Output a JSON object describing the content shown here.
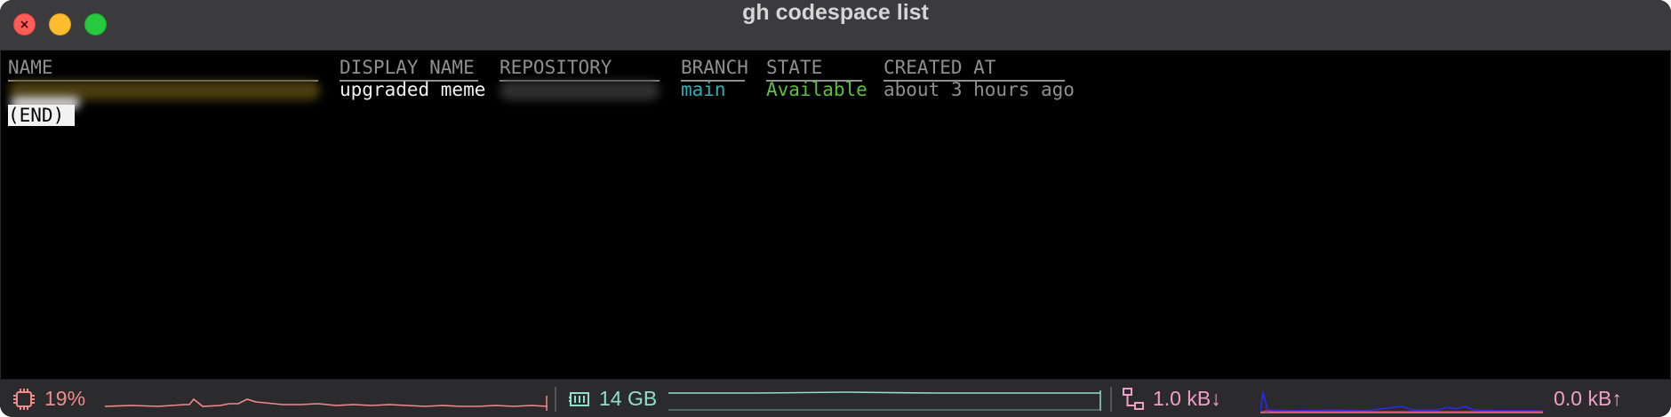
{
  "window": {
    "title": "gh codespace list"
  },
  "table": {
    "headers": {
      "name": "NAME",
      "display_name": "DISPLAY NAME",
      "repository": "REPOSITORY",
      "branch": "BRANCH",
      "state": "STATE",
      "created_at": "CREATED AT"
    },
    "rows": [
      {
        "name": "",
        "display_name": "upgraded meme",
        "repository": "",
        "branch": "main",
        "state": "Available",
        "created_at": "about 3 hours ago"
      }
    ]
  },
  "pager": {
    "end_marker": "(END)"
  },
  "status_bar": {
    "cpu": {
      "value": "19%",
      "icon": "cpu-icon",
      "color": "#f28a8a"
    },
    "memory": {
      "value": "14 GB",
      "icon": "memory-icon",
      "color": "#8fe0c6"
    },
    "network_down": {
      "value": "1.0 kB↓",
      "icon": "network-icon",
      "color": "#f0a0c8"
    },
    "network_up": {
      "value": "0.0 kB↑",
      "color": "#f0a0c8"
    }
  },
  "colors": {
    "branch": "#2ab1b7",
    "state_available": "#5cc13a",
    "header": "#8f8f8f",
    "text": "#e9e9e9"
  }
}
